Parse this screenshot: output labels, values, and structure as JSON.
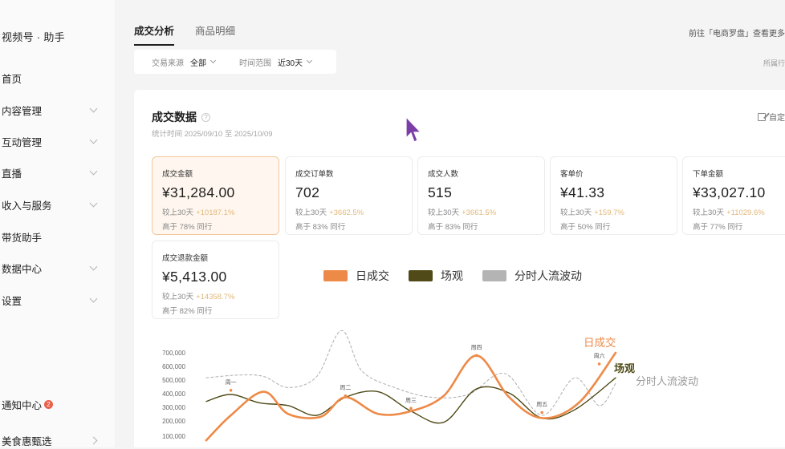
{
  "sidebar": {
    "brand": "视频号 · 助手",
    "items": [
      {
        "label": "首页",
        "chevron": false
      },
      {
        "label": "内容管理",
        "chevron": true
      },
      {
        "label": "互动管理",
        "chevron": true
      },
      {
        "label": "直播",
        "chevron": true
      },
      {
        "label": "收入与服务",
        "chevron": true
      },
      {
        "label": "带货助手",
        "chevron": false
      },
      {
        "label": "数据中心",
        "chevron": true
      },
      {
        "label": "设置",
        "chevron": true
      }
    ],
    "notifications": {
      "label": "通知中心",
      "count": "2"
    },
    "account": {
      "label": "美食惠甄选"
    }
  },
  "tabs": [
    {
      "label": "成交分析",
      "active": true
    },
    {
      "label": "商品明细",
      "active": false
    }
  ],
  "top_link": "前往「电商罗盘」查看更多",
  "filters": {
    "source_label": "交易来源",
    "source_value": "全部",
    "range_label": "时间范围",
    "range_value": "近30天"
  },
  "right_tag": "所属行",
  "card": {
    "title": "成交数据",
    "subtitle": "统计时间 2025/09/10 至 2025/10/09",
    "custom_label": "自定"
  },
  "metrics": [
    {
      "label": "成交金额",
      "value": "¥31,284.00",
      "compare": "较上30天",
      "change": "+10187.1%",
      "rank": "高于 78% 同行"
    },
    {
      "label": "成交订单数",
      "value": "702",
      "compare": "较上30天",
      "change": "+3662.5%",
      "rank": "高于 83% 同行"
    },
    {
      "label": "成交人数",
      "value": "515",
      "compare": "较上30天",
      "change": "+3661.5%",
      "rank": "高于 83% 同行"
    },
    {
      "label": "客单价",
      "value": "¥41.33",
      "compare": "较上30天",
      "change": "+159.7%",
      "rank": "高于 50% 同行"
    },
    {
      "label": "下单金额",
      "value": "¥33,027.10",
      "compare": "较上30天",
      "change": "+11029.6%",
      "rank": "高于 77% 同行"
    },
    {
      "label": "成交退款金额",
      "value": "¥5,413.00",
      "compare": "较上30天",
      "change": "+14358.7%",
      "rank": "高于 82% 同行"
    }
  ],
  "colors": {
    "orange": "#ee8a47",
    "olive": "#4f4a17",
    "gray": "#b4b4b4",
    "active_bg": "#fff7ef"
  },
  "chart_data": {
    "type": "line",
    "legend": [
      {
        "name": "日成交",
        "color": "#ee8a47"
      },
      {
        "name": "场观",
        "color": "#4f4a17"
      },
      {
        "name": "分时人流波动",
        "color": "#b4b4b4"
      }
    ],
    "y_ticks": [
      "700,000",
      "600,000",
      "500,000",
      "400,000",
      "300,000",
      "200,000",
      "100,000"
    ],
    "ylim": [
      100000,
      700000
    ],
    "point_labels": [
      "周一",
      "周二",
      "周三",
      "周四",
      "周五",
      "周六"
    ],
    "series": [
      {
        "name": "日成交",
        "color": "#ee8a47",
        "dash": false,
        "width": 2.6,
        "x": [
          0,
          6,
          14,
          20,
          28,
          34,
          42,
          50,
          58,
          66,
          74,
          82,
          91,
          100
        ],
        "values": [
          70000,
          250000,
          420000,
          260000,
          240000,
          380000,
          260000,
          280000,
          390000,
          680000,
          380000,
          230000,
          340000,
          700000
        ]
      },
      {
        "name": "场观",
        "color": "#4f4a17",
        "dash": false,
        "width": 1.4,
        "x": [
          0,
          6,
          13,
          20,
          27,
          34,
          42,
          50,
          58,
          66,
          74,
          82,
          90,
          100
        ],
        "values": [
          350000,
          400000,
          340000,
          320000,
          250000,
          380000,
          420000,
          280000,
          200000,
          440000,
          410000,
          230000,
          290000,
          520000
        ]
      },
      {
        "name": "分时人流波动",
        "color": "#b4b4b4",
        "dash": true,
        "width": 1.1,
        "x": [
          0,
          8,
          14,
          20,
          27,
          33,
          38,
          46,
          55,
          64,
          73,
          82,
          90,
          96,
          100
        ],
        "values": [
          520000,
          540000,
          530000,
          450000,
          530000,
          860000,
          570000,
          450000,
          380000,
          400000,
          550000,
          250000,
          520000,
          320000,
          480000
        ]
      }
    ],
    "label_points": [
      {
        "label": "周一",
        "x": 6,
        "value": 430000
      },
      {
        "label": "周二",
        "x": 34,
        "value": 390000
      },
      {
        "label": "周三",
        "x": 50,
        "value": 300000
      },
      {
        "label": "周四",
        "x": 66,
        "value": 680000
      },
      {
        "label": "周五",
        "x": 82,
        "value": 270000
      },
      {
        "label": "周六",
        "x": 96,
        "value": 620000
      }
    ],
    "end_labels": [
      "日成交",
      "场观",
      "分时人流波动"
    ]
  }
}
